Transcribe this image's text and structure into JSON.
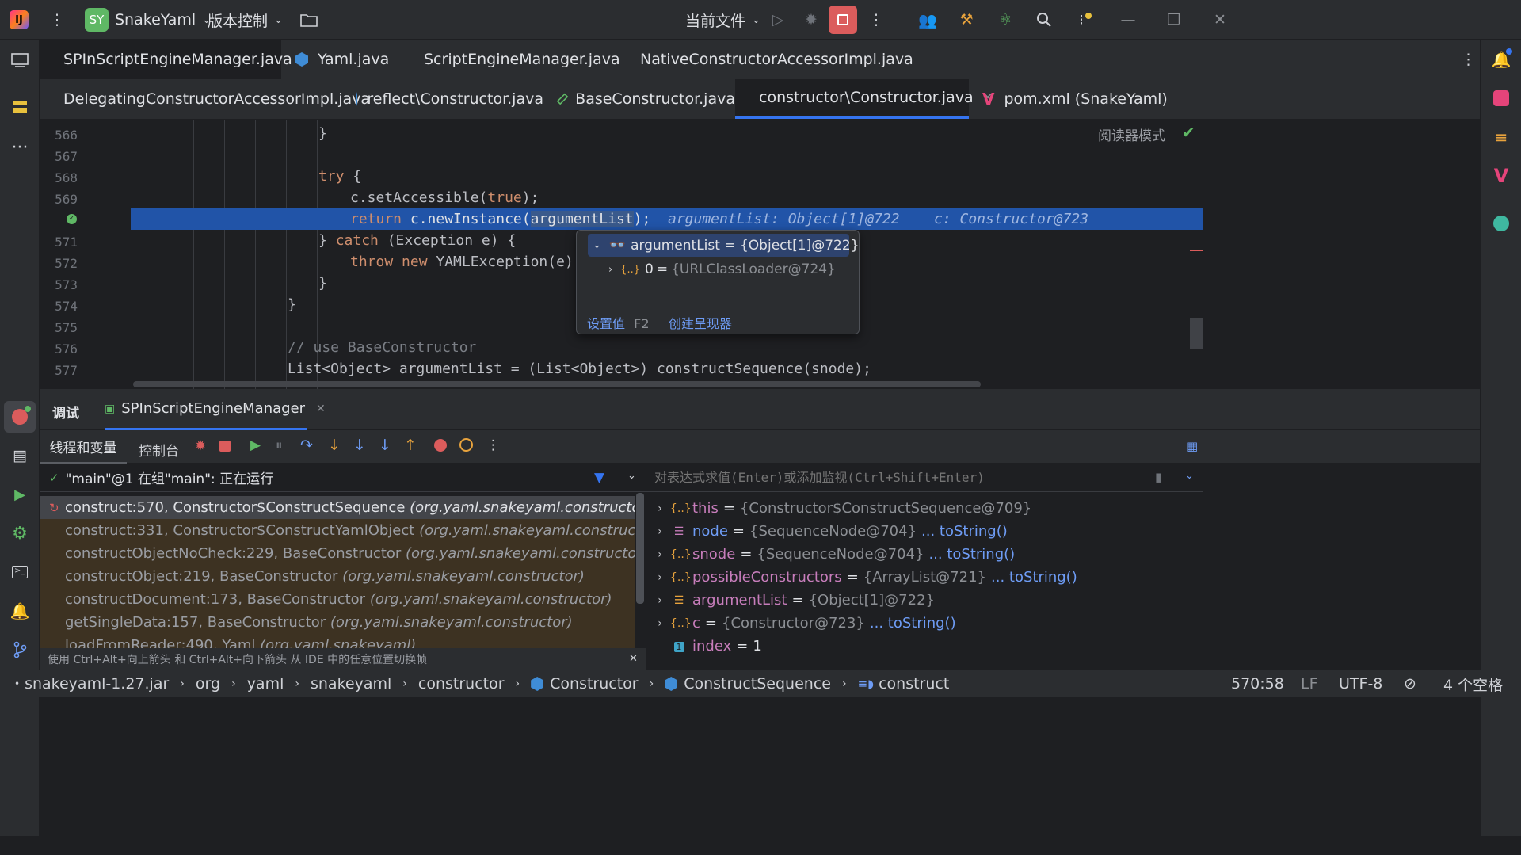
{
  "titlebar": {
    "project_badge": "SY",
    "project_name": "SnakeYaml",
    "vcs_label": "版本控制",
    "run_config": "当前文件"
  },
  "tabs_row1": [
    {
      "label": "SPInScriptEngineManager.java"
    },
    {
      "label": "Yaml.java"
    },
    {
      "label": "ScriptEngineManager.java"
    },
    {
      "label": "NativeConstructorAccessorImpl.java"
    }
  ],
  "tabs_row2": [
    {
      "label": "DelegatingConstructorAccessorImpl.java"
    },
    {
      "label": "reflect\\Constructor.java"
    },
    {
      "label": "BaseConstructor.java"
    },
    {
      "label": "constructor\\Constructor.java"
    },
    {
      "label": "pom.xml (SnakeYaml)"
    }
  ],
  "editor": {
    "reader_mode": "阅读器模式",
    "lines": [
      {
        "n": "566",
        "code": "}"
      },
      {
        "n": "567",
        "code": ""
      },
      {
        "n": "568",
        "code": "try {"
      },
      {
        "n": "569",
        "code": "c.setAccessible(true);"
      },
      {
        "n": "",
        "code": "return c.newInstance(argumentList);"
      },
      {
        "n": "571",
        "code": "} catch (Exception e) {"
      },
      {
        "n": "572",
        "code": "throw new YAMLException(e);"
      },
      {
        "n": "573",
        "code": "}"
      },
      {
        "n": "574",
        "code": "}"
      },
      {
        "n": "575",
        "code": ""
      },
      {
        "n": "576",
        "code": "// use BaseConstructor"
      },
      {
        "n": "577",
        "code": "List<Object> argumentList = (List<Object>) constructSequence(snode);"
      }
    ],
    "inline_hint1": "argumentList: Object[1]@722",
    "inline_hint2": "c: Constructor@723"
  },
  "popup": {
    "root": "argumentList = {Object[1]@722}",
    "child_idx": "0",
    "child_val": "{URLClassLoader@724}",
    "set_value": "设置值",
    "set_value_key": "F2",
    "create_renderer": "创建呈现器"
  },
  "debug": {
    "tab_debug": "调试",
    "tab_session": "SPInScriptEngineManager",
    "sub_threads": "线程和变量",
    "sub_console": "控制台",
    "thread_status": "\"main\"@1 在组\"main\": 正在运行",
    "eval_placeholder": "对表达式求值(Enter)或添加监视(Ctrl+Shift+Enter)",
    "frames": [
      {
        "method": "construct:570, Constructor$ConstructSequence",
        "pkg": "(org.yaml.snakeyaml.constructor)"
      },
      {
        "method": "construct:331, Constructor$ConstructYamlObject",
        "pkg": "(org.yaml.snakeyaml.constructor)"
      },
      {
        "method": "constructObjectNoCheck:229, BaseConstructor",
        "pkg": "(org.yaml.snakeyaml.constructor)"
      },
      {
        "method": "constructObject:219, BaseConstructor",
        "pkg": "(org.yaml.snakeyaml.constructor)"
      },
      {
        "method": "constructDocument:173, BaseConstructor",
        "pkg": "(org.yaml.snakeyaml.constructor)"
      },
      {
        "method": "getSingleData:157, BaseConstructor",
        "pkg": "(org.yaml.snakeyaml.constructor)"
      },
      {
        "method": "loadFromReader:490, Yaml",
        "pkg": "(org.yaml.snakeyaml)"
      }
    ],
    "hint": "使用 Ctrl+Alt+向上箭头 和 Ctrl+Alt+向下箭头 从 IDE 中的任意位置切换帧",
    "vars": [
      {
        "name": "this",
        "value": "{Constructor$ConstructSequence@709}",
        "link": ""
      },
      {
        "name": "node",
        "value": "{SequenceNode@704}",
        "link": "... toString()"
      },
      {
        "name": "snode",
        "value": "{SequenceNode@704}",
        "link": "... toString()"
      },
      {
        "name": "possibleConstructors",
        "value": "{ArrayList@721}",
        "link": "... toString()"
      },
      {
        "name": "argumentList",
        "value": "{Object[1]@722}",
        "link": ""
      },
      {
        "name": "c",
        "value": "{Constructor@723}",
        "link": "... toString()"
      },
      {
        "name": "index",
        "value": "1",
        "link": ""
      }
    ]
  },
  "status": {
    "crumbs": [
      "snakeyaml-1.27.jar",
      "org",
      "yaml",
      "snakeyaml",
      "constructor",
      "Constructor",
      "ConstructSequence",
      "construct"
    ],
    "position": "570:58",
    "line_sep": "LF",
    "encoding": "UTF-8",
    "indent": "4 个空格"
  }
}
